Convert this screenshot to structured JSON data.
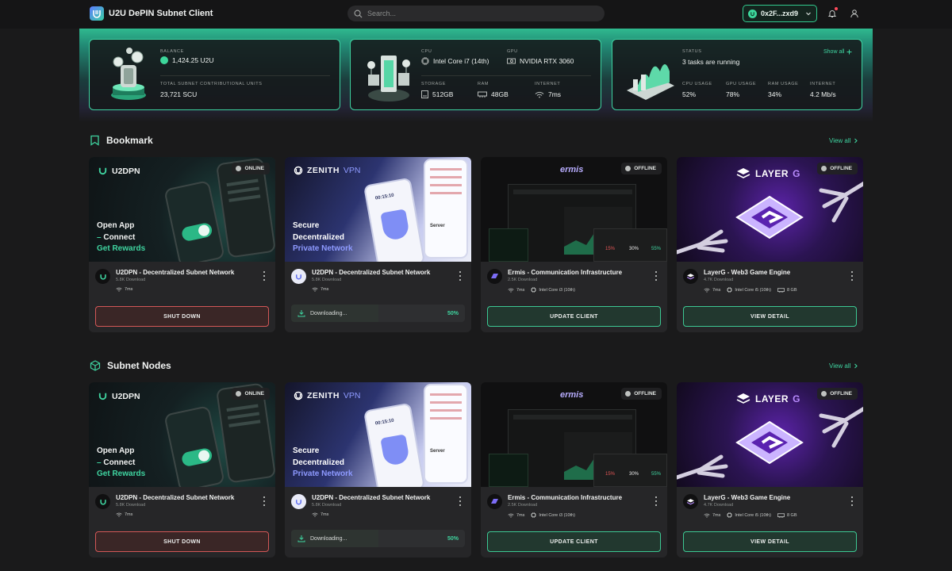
{
  "app": {
    "title": "U2U DePIN Subnet Client"
  },
  "search": {
    "placeholder": "Search..."
  },
  "wallet": {
    "address": "0x2F...zxd9"
  },
  "balance_card": {
    "balance_label": "BALANCE",
    "balance_value": "1,424.25 U2U",
    "scu_label": "TOTAL SUBNET CONTRIBUTIONAL UNITS",
    "scu_value": "23,721 SCU"
  },
  "hardware_card": {
    "cpu_label": "CPU",
    "cpu_value": "Intel Core i7 (14th)",
    "gpu_label": "GPU",
    "gpu_value": "NVIDIA RTX 3060",
    "storage_label": "STORAGE",
    "storage_value": "512GB",
    "ram_label": "RAM",
    "ram_value": "48GB",
    "internet_label": "INTERNET",
    "internet_value": "7ms"
  },
  "status_card": {
    "status_label": "STATUS",
    "status_value": "3 tasks are running",
    "show_all": "Show all",
    "cpu_usage_label": "CPU USAGE",
    "cpu_usage": "52%",
    "gpu_usage_label": "GPU USAGE",
    "gpu_usage": "78%",
    "ram_usage_label": "RAM USAGE",
    "ram_usage": "34%",
    "internet_label": "INTERNET",
    "internet": "4.2 Mb/s"
  },
  "sections": [
    {
      "title": "Bookmark",
      "view_all": "View all"
    },
    {
      "title": "Subnet Nodes",
      "view_all": "View all"
    }
  ],
  "apps": [
    {
      "name": "U2DPN - Decentralized Subnet Network",
      "downloads": "5.8K Download",
      "latency": "7ms",
      "badge": "ONLINE",
      "action": "SHUT DOWN",
      "banner": {
        "brand": "U2DPN",
        "line1": "Open App",
        "line2": "Connect",
        "line3": "Get Rewards"
      }
    },
    {
      "name": "U2DPN - Decentralized Subnet Network",
      "downloads": "5.8K Download",
      "latency": "7ms",
      "downloading": "Downloading...",
      "progress": "50%",
      "progress_fraction": 0.5,
      "banner": {
        "brand": "ZENITH",
        "brand2": "VPN",
        "line1": "Secure",
        "line2": "Decentralized",
        "line3": "Private Network",
        "server": "Server",
        "timer": "00:15:10"
      }
    },
    {
      "name": "Ermis - Communication Infrastructure",
      "downloads": "2.5K Download",
      "latency": "7ms",
      "cpu": "Intel Core i3 (10th)",
      "badge": "OFFLINE",
      "action": "UPDATE CLIENT",
      "banner": {
        "brand": "ermis",
        "stat1": "15%",
        "stat2": "30%",
        "stat3": "55%"
      }
    },
    {
      "name": "LayerG - Web3 Game Engine",
      "downloads": "4.7K Download",
      "latency": "7ms",
      "cpu": "Intel Core i5 (10th)",
      "ram": "8 GB",
      "badge": "OFFLINE",
      "action": "VIEW DETAIL",
      "banner": {
        "brand": "LAYER",
        "brand2": "G"
      }
    }
  ],
  "colors": {
    "accent": "#3fd4a0",
    "danger": "#d25757",
    "background": "#1a1a1b",
    "card": "#262628"
  }
}
